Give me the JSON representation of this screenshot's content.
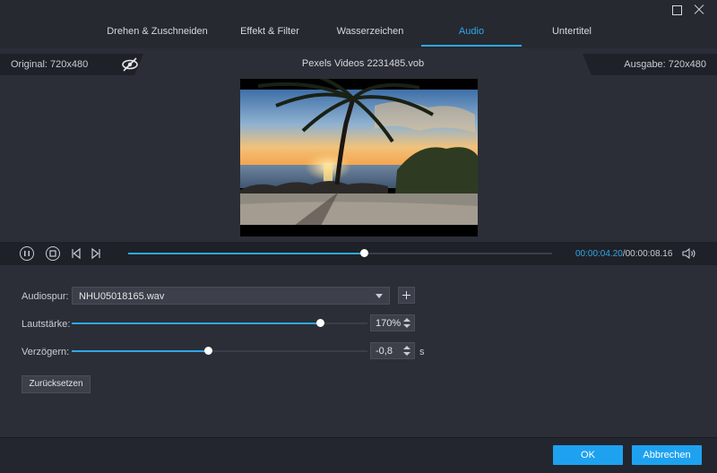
{
  "tabs": [
    {
      "label": "Drehen & Zuschneiden"
    },
    {
      "label": "Effekt & Filter"
    },
    {
      "label": "Wasserzeichen"
    },
    {
      "label": "Audio"
    },
    {
      "label": "Untertitel"
    }
  ],
  "active_tab": "Audio",
  "info": {
    "original": "Original: 720x480",
    "filename": "Pexels Videos 2231485.vob",
    "output": "Ausgabe: 720x480"
  },
  "playback": {
    "current_time": "00:00:04.20",
    "total_time": "/00:00:08.16",
    "progress": 0.555
  },
  "audio": {
    "track_label": "Audiospur:",
    "track_value": "NHU05018165.wav",
    "volume_label": "Lautstärke:",
    "volume_value": "170%",
    "volume_level": 0.84,
    "delay_label": "Verzögern:",
    "delay_value": "-0,8",
    "delay_level": 0.46,
    "delay_unit": "s",
    "reset_label": "Zurücksetzen"
  },
  "footer": {
    "ok_label": "OK",
    "cancel_label": "Abbrechen"
  },
  "colors": {
    "accent": "#2fa8e8",
    "button": "#1ea2f0",
    "background": "#2b2e37"
  }
}
